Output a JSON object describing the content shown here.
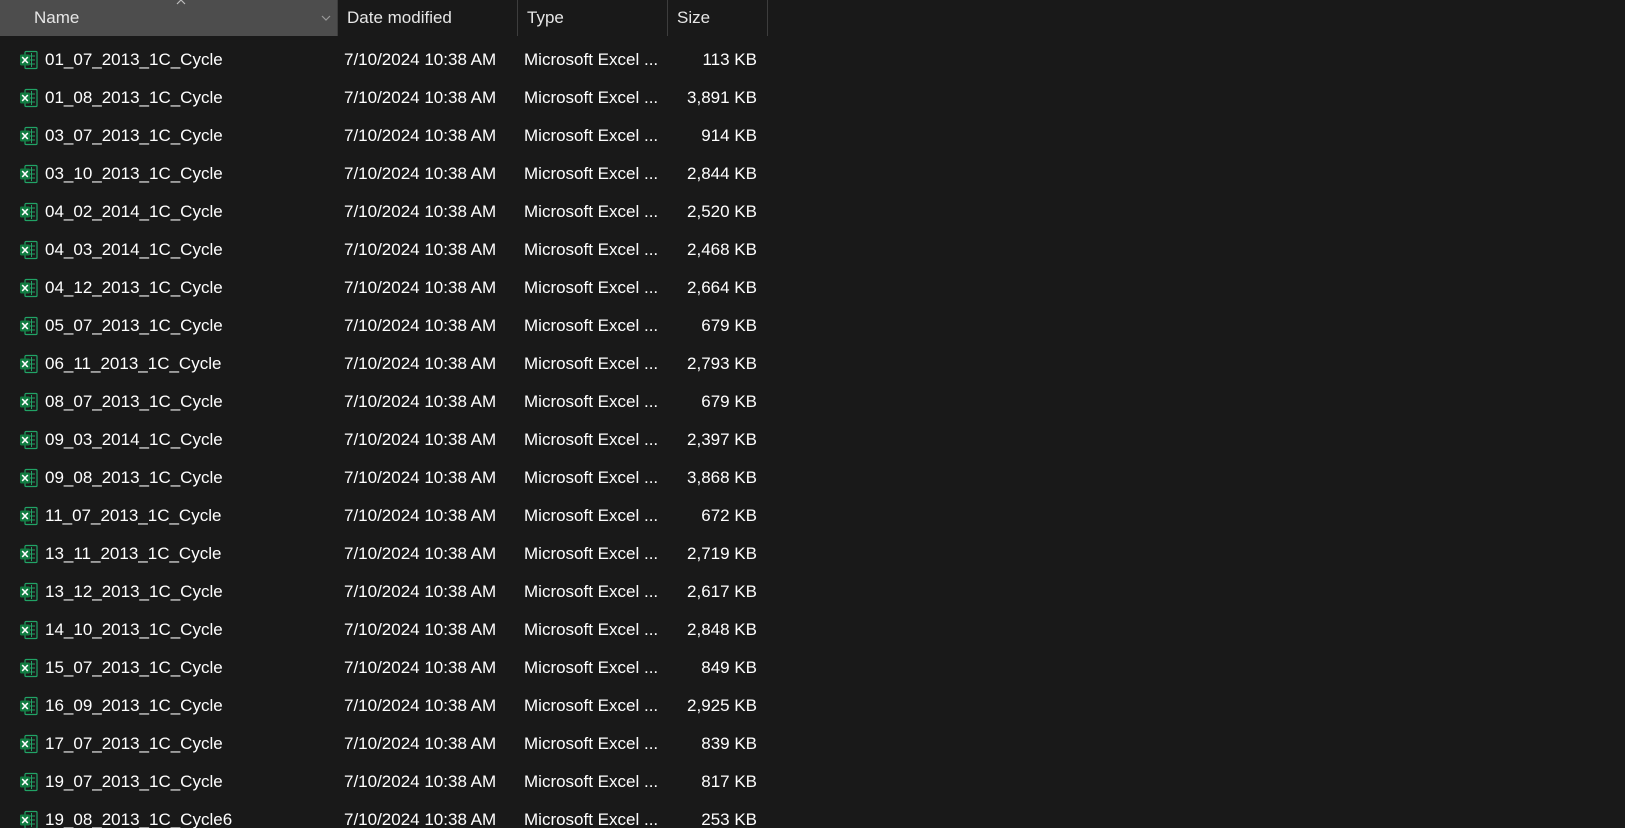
{
  "columns": {
    "name": "Name",
    "date_modified": "Date modified",
    "type": "Type",
    "size": "Size"
  },
  "icons": {
    "file_icon": "excel-file-icon",
    "sort_indicator": "sort-up-icon",
    "column_dropdown": "chevron-down-icon"
  },
  "colors": {
    "background": "#191919",
    "header_selected": "#4d4d4d",
    "excel_green": "#21a366"
  },
  "files": [
    {
      "name": "01_07_2013_1C_Cycle",
      "date": "7/10/2024 10:38 AM",
      "type": "Microsoft Excel ...",
      "size": "113 KB"
    },
    {
      "name": "01_08_2013_1C_Cycle",
      "date": "7/10/2024 10:38 AM",
      "type": "Microsoft Excel ...",
      "size": "3,891 KB"
    },
    {
      "name": "03_07_2013_1C_Cycle",
      "date": "7/10/2024 10:38 AM",
      "type": "Microsoft Excel ...",
      "size": "914 KB"
    },
    {
      "name": "03_10_2013_1C_Cycle",
      "date": "7/10/2024 10:38 AM",
      "type": "Microsoft Excel ...",
      "size": "2,844 KB"
    },
    {
      "name": "04_02_2014_1C_Cycle",
      "date": "7/10/2024 10:38 AM",
      "type": "Microsoft Excel ...",
      "size": "2,520 KB"
    },
    {
      "name": "04_03_2014_1C_Cycle",
      "date": "7/10/2024 10:38 AM",
      "type": "Microsoft Excel ...",
      "size": "2,468 KB"
    },
    {
      "name": "04_12_2013_1C_Cycle",
      "date": "7/10/2024 10:38 AM",
      "type": "Microsoft Excel ...",
      "size": "2,664 KB"
    },
    {
      "name": "05_07_2013_1C_Cycle",
      "date": "7/10/2024 10:38 AM",
      "type": "Microsoft Excel ...",
      "size": "679 KB"
    },
    {
      "name": "06_11_2013_1C_Cycle",
      "date": "7/10/2024 10:38 AM",
      "type": "Microsoft Excel ...",
      "size": "2,793 KB"
    },
    {
      "name": "08_07_2013_1C_Cycle",
      "date": "7/10/2024 10:38 AM",
      "type": "Microsoft Excel ...",
      "size": "679 KB"
    },
    {
      "name": "09_03_2014_1C_Cycle",
      "date": "7/10/2024 10:38 AM",
      "type": "Microsoft Excel ...",
      "size": "2,397 KB"
    },
    {
      "name": "09_08_2013_1C_Cycle",
      "date": "7/10/2024 10:38 AM",
      "type": "Microsoft Excel ...",
      "size": "3,868 KB"
    },
    {
      "name": "11_07_2013_1C_Cycle",
      "date": "7/10/2024 10:38 AM",
      "type": "Microsoft Excel ...",
      "size": "672 KB"
    },
    {
      "name": "13_11_2013_1C_Cycle",
      "date": "7/10/2024 10:38 AM",
      "type": "Microsoft Excel ...",
      "size": "2,719 KB"
    },
    {
      "name": "13_12_2013_1C_Cycle",
      "date": "7/10/2024 10:38 AM",
      "type": "Microsoft Excel ...",
      "size": "2,617 KB"
    },
    {
      "name": "14_10_2013_1C_Cycle",
      "date": "7/10/2024 10:38 AM",
      "type": "Microsoft Excel ...",
      "size": "2,848 KB"
    },
    {
      "name": "15_07_2013_1C_Cycle",
      "date": "7/10/2024 10:38 AM",
      "type": "Microsoft Excel ...",
      "size": "849 KB"
    },
    {
      "name": "16_09_2013_1C_Cycle",
      "date": "7/10/2024 10:38 AM",
      "type": "Microsoft Excel ...",
      "size": "2,925 KB"
    },
    {
      "name": "17_07_2013_1C_Cycle",
      "date": "7/10/2024 10:38 AM",
      "type": "Microsoft Excel ...",
      "size": "839 KB"
    },
    {
      "name": "19_07_2013_1C_Cycle",
      "date": "7/10/2024 10:38 AM",
      "type": "Microsoft Excel ...",
      "size": "817 KB"
    },
    {
      "name": "19_08_2013_1C_Cycle6",
      "date": "7/10/2024 10:38 AM",
      "type": "Microsoft Excel ...",
      "size": "253 KB"
    }
  ]
}
